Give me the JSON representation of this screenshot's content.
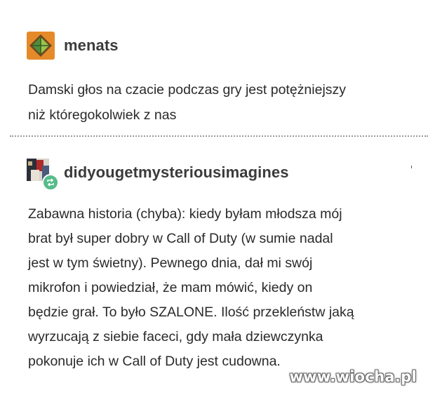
{
  "posts": [
    {
      "username": "menats",
      "avatar_icon": "orange-diamond-avatar-icon",
      "lines": [
        "Damski głos na czacie podczas gry jest potężniejszy",
        "niż któregokolwiek z nas"
      ]
    },
    {
      "username": "didyougetmysteriousimagines",
      "avatar_icon": "photo-avatar-icon",
      "badge_icon": "reblog-icon",
      "lines": [
        "Zabawna historia (chyba): kiedy byłam młodsza mój",
        "brat był super dobry w Call of Duty (w sumie nadal",
        "jest w tym świetny). Pewnego dnia, dał mi swój",
        "mikrofon i powiedział, że mam mówić, kiedy on",
        "będzie grał. To było SZALONE. Ilość przekleństw jaką",
        "wyrzucają z siebie faceci, gdy mała dziewczynka",
        "pokonuje ich w Call of Duty jest cudowna."
      ]
    }
  ],
  "watermark": "www.wiocha.pl",
  "colors": {
    "avatar_orange": "#e58a2a",
    "reblog_green": "#56bc8a",
    "text": "#2a2a2a"
  }
}
